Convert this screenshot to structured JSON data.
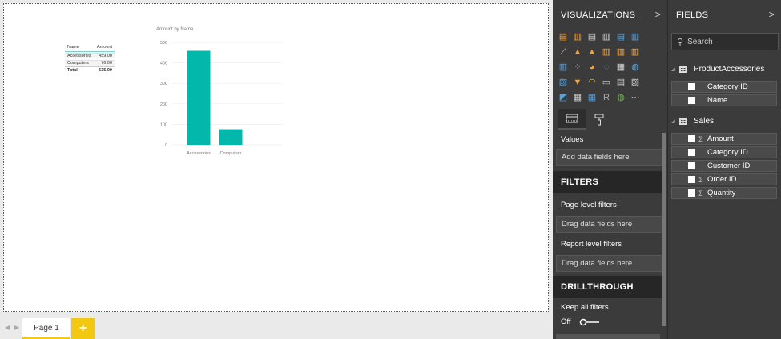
{
  "table_visual": {
    "headers": [
      "Name",
      "Amount"
    ],
    "rows": [
      [
        "Accessories",
        "459.00"
      ],
      [
        "Computers",
        "76.00"
      ]
    ],
    "total": [
      "Total",
      "535.00"
    ]
  },
  "chart_data": {
    "type": "bar",
    "title": "Amount by Name",
    "categories": [
      "Accessories",
      "Computers"
    ],
    "values": [
      459,
      76
    ],
    "yticks": [
      0,
      100,
      200,
      300,
      400,
      500
    ],
    "ylim": [
      0,
      500
    ],
    "bar_color": "#01b8aa",
    "grid": true
  },
  "tabs": {
    "page1": "Page 1",
    "add": "+"
  },
  "viz_pane": {
    "title": "VISUALIZATIONS",
    "values_label": "Values",
    "values_placeholder": "Add data fields here",
    "filters_title": "FILTERS",
    "page_filters_label": "Page level filters",
    "page_filters_placeholder": "Drag data fields here",
    "report_filters_label": "Report level filters",
    "report_filters_placeholder": "Drag data fields here",
    "drill_title": "DRILLTHROUGH",
    "keep_filters_label": "Keep all filters",
    "toggle_label": "Off",
    "icons": [
      {
        "glyph": "▤",
        "color": "#f2a33a"
      },
      {
        "glyph": "▥",
        "color": "#f2a33a"
      },
      {
        "glyph": "▤",
        "color": "#cfcfcf"
      },
      {
        "glyph": "▥",
        "color": "#cfcfcf"
      },
      {
        "glyph": "▤",
        "color": "#5aa2dc"
      },
      {
        "glyph": "▥",
        "color": "#5aa2dc"
      },
      {
        "glyph": "",
        "color": "#3b3b3b"
      },
      {
        "glyph": "⟋",
        "color": "#cfcfcf"
      },
      {
        "glyph": "▲",
        "color": "#f2a33a"
      },
      {
        "glyph": "▲",
        "color": "#f2a33a"
      },
      {
        "glyph": "▥",
        "color": "#f2a33a"
      },
      {
        "glyph": "▥",
        "color": "#f2a33a"
      },
      {
        "glyph": "▥",
        "color": "#f2a33a"
      },
      {
        "glyph": "",
        "color": "#3b3b3b"
      },
      {
        "glyph": "▥",
        "color": "#5aa2dc"
      },
      {
        "glyph": "⁘",
        "color": "#cfcfcf"
      },
      {
        "glyph": "◕",
        "color": "#f2a33a"
      },
      {
        "glyph": "◌",
        "color": "#5aa2dc"
      },
      {
        "glyph": "▦",
        "color": "#cfcfcf"
      },
      {
        "glyph": "◍",
        "color": "#5aa2dc"
      },
      {
        "glyph": "",
        "color": "#3b3b3b"
      },
      {
        "glyph": "▨",
        "color": "#5aa2dc"
      },
      {
        "glyph": "▼",
        "color": "#f2a33a"
      },
      {
        "glyph": "◠",
        "color": "#f2c811"
      },
      {
        "glyph": "▭",
        "color": "#cfcfcf"
      },
      {
        "glyph": "▤",
        "color": "#cfcfcf"
      },
      {
        "glyph": "▨",
        "color": "#cfcfcf"
      },
      {
        "glyph": "",
        "color": "#3b3b3b"
      },
      {
        "glyph": "◩",
        "color": "#5aa2dc"
      },
      {
        "glyph": "▦",
        "color": "#cfcfcf"
      },
      {
        "glyph": "▦",
        "color": "#5aa2dc"
      },
      {
        "glyph": "R",
        "color": "#aaaaaa"
      },
      {
        "glyph": "◍",
        "color": "#6ab04c"
      },
      {
        "glyph": "⋯",
        "color": "#cfcfcf"
      },
      {
        "glyph": "",
        "color": "#3b3b3b"
      }
    ],
    "icon_names": [
      "stacked-bar-icon",
      "stacked-column-icon",
      "clustered-bar-icon",
      "clustered-column-icon",
      "100-bar-icon",
      "100-column-icon",
      "blank",
      "line-chart-icon",
      "area-chart-icon",
      "stacked-area-icon",
      "line-column-icon",
      "line-clustered-icon",
      "ribbon-chart-icon",
      "blank",
      "waterfall-icon",
      "scatter-icon",
      "pie-chart-icon",
      "donut-chart-icon",
      "treemap-icon",
      "map-icon",
      "blank",
      "filled-map-icon",
      "funnel-icon",
      "gauge-icon",
      "card-icon",
      "multirow-card-icon",
      "kpi-icon",
      "blank",
      "slicer-icon",
      "table-icon",
      "matrix-icon",
      "r-visual-icon",
      "globe-icon",
      "more-visuals-icon",
      "blank"
    ]
  },
  "fields_pane": {
    "title": "FIELDS",
    "search_placeholder": "Search",
    "tables": [
      {
        "name": "ProductAccessories",
        "fields": [
          {
            "name": "Category ID",
            "sigma": false
          },
          {
            "name": "Name",
            "sigma": false
          }
        ]
      },
      {
        "name": "Sales",
        "fields": [
          {
            "name": "Amount",
            "sigma": true
          },
          {
            "name": "Category ID",
            "sigma": false
          },
          {
            "name": "Customer ID",
            "sigma": false
          },
          {
            "name": "Order ID",
            "sigma": true
          },
          {
            "name": "Quantity",
            "sigma": true
          }
        ]
      }
    ],
    "sigma_glyph": "Σ"
  }
}
